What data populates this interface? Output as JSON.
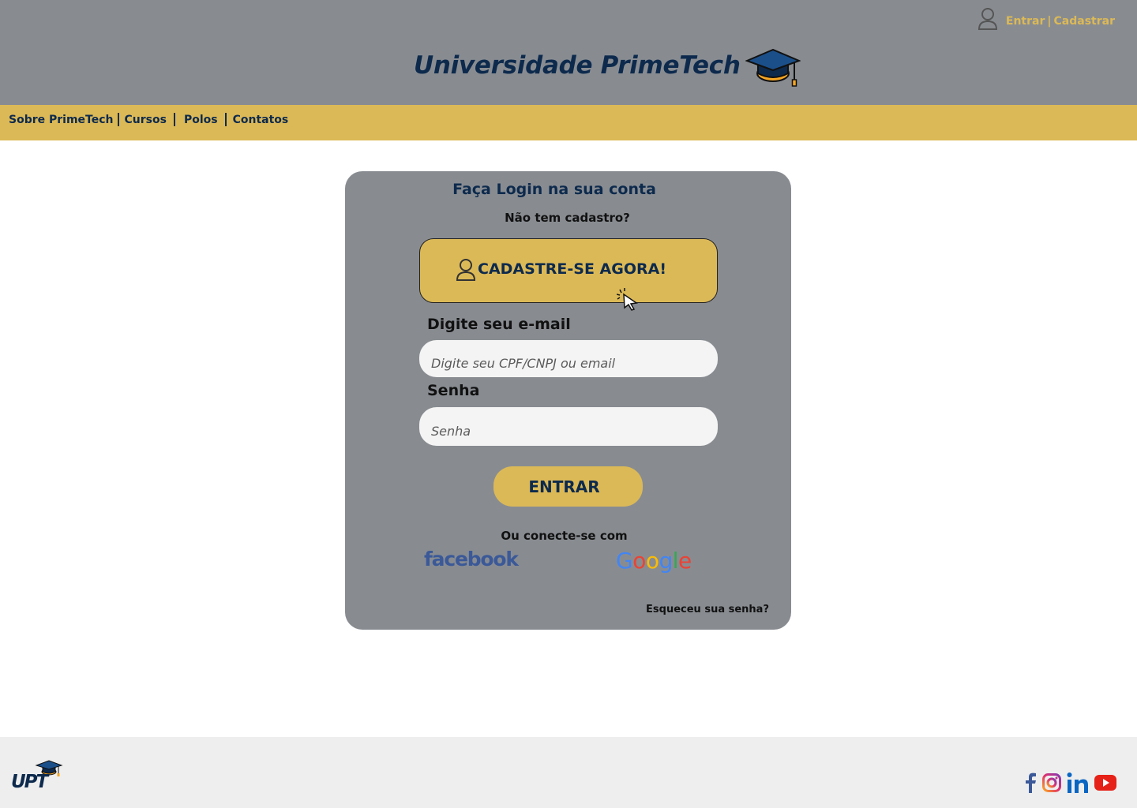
{
  "header": {
    "brand_title": "Universidade PrimeTech",
    "login_link": "Entrar",
    "separator": "|",
    "signup_link": "Cadastrar"
  },
  "nav": {
    "items": [
      "Sobre PrimeTech",
      "Cursos",
      "Polos",
      "Contatos"
    ]
  },
  "login": {
    "title": "Faça Login na sua conta",
    "no_account": "Não tem cadastro?",
    "signup_button": "CADASTRE-SE AGORA!",
    "email_label": "Digite seu e-mail",
    "email_placeholder": "Digite seu CPF/CNPJ ou email",
    "email_value": "",
    "password_label": "Senha",
    "password_placeholder": "Senha",
    "password_value": "",
    "enter_button": "ENTRAR",
    "connect_text": "Ou conecte-se com",
    "facebook": "facebook",
    "google_letters": [
      "G",
      "o",
      "o",
      "g",
      "l",
      "e"
    ],
    "forgot_password": "Esqueceu sua senha?"
  },
  "footer": {
    "logo_text": "UPT",
    "socials": [
      "facebook-icon",
      "instagram-icon",
      "linkedin-icon",
      "youtube-icon"
    ]
  },
  "colors": {
    "header_bg": "#888c91",
    "accent_gold": "#dcb957",
    "navy": "#0d2a4d",
    "footer_bg": "#eeeeee"
  }
}
